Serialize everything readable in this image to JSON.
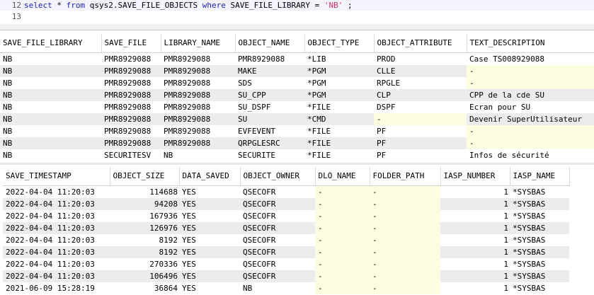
{
  "editor": {
    "lines": [
      {
        "num": "12",
        "tokens": [
          {
            "t": "select",
            "c": "kw"
          },
          {
            "t": " * ",
            "c": ""
          },
          {
            "t": "from",
            "c": "kw"
          },
          {
            "t": " qsys2.SAVE_FILE_OBJECTS ",
            "c": ""
          },
          {
            "t": "where",
            "c": "kw"
          },
          {
            "t": " SAVE_FILE_LIBRARY = ",
            "c": ""
          },
          {
            "t": "'NB'",
            "c": "str"
          },
          {
            "t": " ;",
            "c": ""
          }
        ]
      },
      {
        "num": "13",
        "tokens": []
      }
    ]
  },
  "table1": {
    "columns": [
      "SAVE_FILE_LIBRARY",
      "SAVE_FILE",
      "LIBRARY_NAME",
      "OBJECT_NAME",
      "OBJECT_TYPE",
      "OBJECT_ATTRIBUTE",
      "TEXT_DESCRIPTION"
    ],
    "rows": [
      [
        "NB",
        "PMR8929088",
        "PMR8929088",
        "PMR8929088",
        "*LIB",
        "PROD",
        "Case TS008929088"
      ],
      [
        "NB",
        "PMR8929088",
        "PMR8929088",
        "MAKE",
        "*PGM",
        "CLLE",
        "-"
      ],
      [
        "NB",
        "PMR8929088",
        "PMR8929088",
        "SDS",
        "*PGM",
        "RPGLE",
        "-"
      ],
      [
        "NB",
        "PMR8929088",
        "PMR8929088",
        "SU_CPP",
        "*PGM",
        "CLP",
        "CPP de la cde SU"
      ],
      [
        "NB",
        "PMR8929088",
        "PMR8929088",
        "SU_DSPF",
        "*FILE",
        "DSPF",
        "Ecran pour SU"
      ],
      [
        "NB",
        "PMR8929088",
        "PMR8929088",
        "SU",
        "*CMD",
        "-",
        "Devenir SuperUtilisateur"
      ],
      [
        "NB",
        "PMR8929088",
        "PMR8929088",
        "EVFEVENT",
        "*FILE",
        "PF",
        "-"
      ],
      [
        "NB",
        "PMR8929088",
        "PMR8929088",
        "QRPGLESRC",
        "*FILE",
        "PF",
        "-"
      ],
      [
        "NB",
        "SECURITESV",
        "NB",
        "SECURITE",
        "*FILE",
        "PF",
        "Infos de sécurité"
      ]
    ]
  },
  "table2": {
    "columns": [
      "SAVE_TIMESTAMP",
      "OBJECT_SIZE",
      "DATA_SAVED",
      "OBJECT_OWNER",
      "DLO_NAME",
      "FOLDER_PATH",
      "IASP_NUMBER",
      "IASP_NAME"
    ],
    "rows": [
      [
        "2022-04-04 11:20:03",
        "114688",
        "YES",
        "QSECOFR",
        "-",
        "-",
        "1",
        "*SYSBAS"
      ],
      [
        "2022-04-04 11:20:03",
        "94208",
        "YES",
        "QSECOFR",
        "-",
        "-",
        "1",
        "*SYSBAS"
      ],
      [
        "2022-04-04 11:20:03",
        "167936",
        "YES",
        "QSECOFR",
        "-",
        "-",
        "1",
        "*SYSBAS"
      ],
      [
        "2022-04-04 11:20:03",
        "126976",
        "YES",
        "QSECOFR",
        "-",
        "-",
        "1",
        "*SYSBAS"
      ],
      [
        "2022-04-04 11:20:03",
        "8192",
        "YES",
        "QSECOFR",
        "-",
        "-",
        "1",
        "*SYSBAS"
      ],
      [
        "2022-04-04 11:20:03",
        "8192",
        "YES",
        "QSECOFR",
        "-",
        "-",
        "1",
        "*SYSBAS"
      ],
      [
        "2022-04-04 11:20:03",
        "270336",
        "YES",
        "QSECOFR",
        "-",
        "-",
        "1",
        "*SYSBAS"
      ],
      [
        "2022-04-04 11:20:03",
        "106496",
        "YES",
        "QSECOFR",
        "-",
        "-",
        "1",
        "*SYSBAS"
      ],
      [
        "2021-06-09 15:28:19",
        "36864",
        "YES",
        "NB",
        "-",
        "-",
        "1",
        "*SYSBAS"
      ]
    ]
  }
}
